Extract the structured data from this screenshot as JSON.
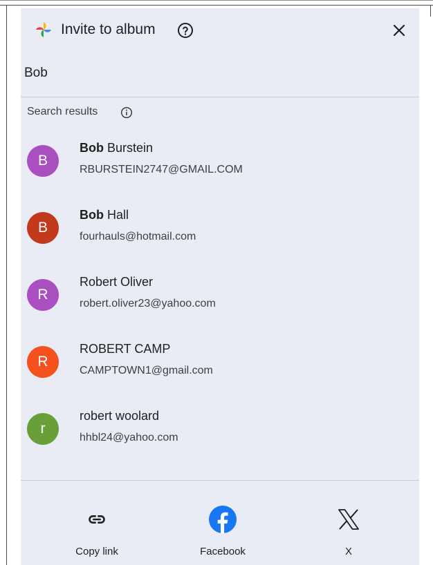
{
  "dialog": {
    "title": "Invite to album",
    "search": {
      "value": "Bob"
    },
    "results_label": "Search results",
    "contacts": [
      {
        "bold": "Bob",
        "rest": " Burstein",
        "email": "RBURSTEIN2747@GMAIL.COM",
        "initial": "B",
        "color": "#a94fc0"
      },
      {
        "bold": "Bob",
        "rest": " Hall",
        "email": "fourhauls@hotmail.com",
        "initial": "B",
        "color": "#c2391b"
      },
      {
        "bold": "",
        "rest": "Robert Oliver",
        "email": "robert.oliver23@yahoo.com",
        "initial": "R",
        "color": "#a94fc0"
      },
      {
        "bold": "",
        "rest": "ROBERT CAMP",
        "email": "CAMPTOWN1@gmail.com",
        "initial": "R",
        "color": "#f4511e"
      },
      {
        "bold": "",
        "rest": "robert woolard",
        "email": "hhbl24@yahoo.com",
        "initial": "r",
        "color": "#689f38"
      }
    ],
    "share": {
      "copy_link": "Copy link",
      "facebook": "Facebook",
      "x": "X"
    }
  },
  "icons": {
    "logo": "google-photos-pinwheel-icon",
    "help": "help-circle-icon",
    "close": "close-icon",
    "info": "info-icon",
    "link": "link-icon",
    "facebook": "facebook-icon",
    "x": "x-logo-icon"
  },
  "colors": {
    "dialog_bg": "#e9ecf4",
    "facebook_blue": "#1877f2"
  }
}
